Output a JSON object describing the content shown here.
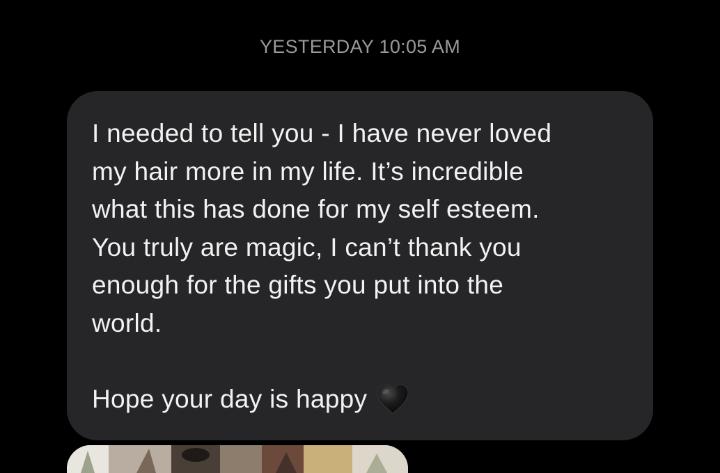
{
  "thread": {
    "timestamp": "YESTERDAY 10:05 AM",
    "message": {
      "body": "I needed to tell you - I have never loved\nmy hair more in my life. It’s incredible\nwhat this has done for my self esteem.\nYou truly are magic, I can’t thank you\nenough for the gifts you put into the\nworld.\n\nHope your day is happy",
      "emoji": "black-heart-icon"
    },
    "attachment": {
      "type": "photo"
    }
  },
  "colors": {
    "background": "#000000",
    "bubble": "#262628",
    "text": "#f2f2f2",
    "timestamp": "#9a9a9e"
  }
}
